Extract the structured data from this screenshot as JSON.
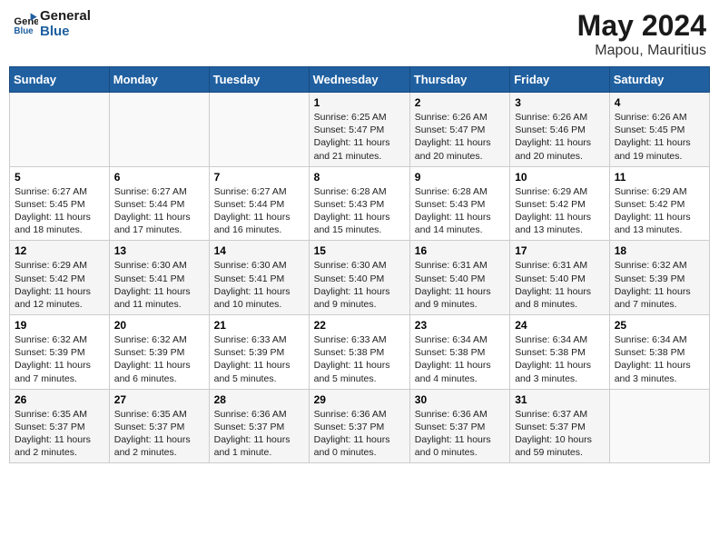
{
  "header": {
    "logo_line1": "General",
    "logo_line2": "Blue",
    "month": "May 2024",
    "location": "Mapou, Mauritius"
  },
  "weekdays": [
    "Sunday",
    "Monday",
    "Tuesday",
    "Wednesday",
    "Thursday",
    "Friday",
    "Saturday"
  ],
  "weeks": [
    [
      {
        "day": "",
        "info": ""
      },
      {
        "day": "",
        "info": ""
      },
      {
        "day": "",
        "info": ""
      },
      {
        "day": "1",
        "info": "Sunrise: 6:25 AM\nSunset: 5:47 PM\nDaylight: 11 hours\nand 21 minutes."
      },
      {
        "day": "2",
        "info": "Sunrise: 6:26 AM\nSunset: 5:47 PM\nDaylight: 11 hours\nand 20 minutes."
      },
      {
        "day": "3",
        "info": "Sunrise: 6:26 AM\nSunset: 5:46 PM\nDaylight: 11 hours\nand 20 minutes."
      },
      {
        "day": "4",
        "info": "Sunrise: 6:26 AM\nSunset: 5:45 PM\nDaylight: 11 hours\nand 19 minutes."
      }
    ],
    [
      {
        "day": "5",
        "info": "Sunrise: 6:27 AM\nSunset: 5:45 PM\nDaylight: 11 hours\nand 18 minutes."
      },
      {
        "day": "6",
        "info": "Sunrise: 6:27 AM\nSunset: 5:44 PM\nDaylight: 11 hours\nand 17 minutes."
      },
      {
        "day": "7",
        "info": "Sunrise: 6:27 AM\nSunset: 5:44 PM\nDaylight: 11 hours\nand 16 minutes."
      },
      {
        "day": "8",
        "info": "Sunrise: 6:28 AM\nSunset: 5:43 PM\nDaylight: 11 hours\nand 15 minutes."
      },
      {
        "day": "9",
        "info": "Sunrise: 6:28 AM\nSunset: 5:43 PM\nDaylight: 11 hours\nand 14 minutes."
      },
      {
        "day": "10",
        "info": "Sunrise: 6:29 AM\nSunset: 5:42 PM\nDaylight: 11 hours\nand 13 minutes."
      },
      {
        "day": "11",
        "info": "Sunrise: 6:29 AM\nSunset: 5:42 PM\nDaylight: 11 hours\nand 13 minutes."
      }
    ],
    [
      {
        "day": "12",
        "info": "Sunrise: 6:29 AM\nSunset: 5:42 PM\nDaylight: 11 hours\nand 12 minutes."
      },
      {
        "day": "13",
        "info": "Sunrise: 6:30 AM\nSunset: 5:41 PM\nDaylight: 11 hours\nand 11 minutes."
      },
      {
        "day": "14",
        "info": "Sunrise: 6:30 AM\nSunset: 5:41 PM\nDaylight: 11 hours\nand 10 minutes."
      },
      {
        "day": "15",
        "info": "Sunrise: 6:30 AM\nSunset: 5:40 PM\nDaylight: 11 hours\nand 9 minutes."
      },
      {
        "day": "16",
        "info": "Sunrise: 6:31 AM\nSunset: 5:40 PM\nDaylight: 11 hours\nand 9 minutes."
      },
      {
        "day": "17",
        "info": "Sunrise: 6:31 AM\nSunset: 5:40 PM\nDaylight: 11 hours\nand 8 minutes."
      },
      {
        "day": "18",
        "info": "Sunrise: 6:32 AM\nSunset: 5:39 PM\nDaylight: 11 hours\nand 7 minutes."
      }
    ],
    [
      {
        "day": "19",
        "info": "Sunrise: 6:32 AM\nSunset: 5:39 PM\nDaylight: 11 hours\nand 7 minutes."
      },
      {
        "day": "20",
        "info": "Sunrise: 6:32 AM\nSunset: 5:39 PM\nDaylight: 11 hours\nand 6 minutes."
      },
      {
        "day": "21",
        "info": "Sunrise: 6:33 AM\nSunset: 5:39 PM\nDaylight: 11 hours\nand 5 minutes."
      },
      {
        "day": "22",
        "info": "Sunrise: 6:33 AM\nSunset: 5:38 PM\nDaylight: 11 hours\nand 5 minutes."
      },
      {
        "day": "23",
        "info": "Sunrise: 6:34 AM\nSunset: 5:38 PM\nDaylight: 11 hours\nand 4 minutes."
      },
      {
        "day": "24",
        "info": "Sunrise: 6:34 AM\nSunset: 5:38 PM\nDaylight: 11 hours\nand 3 minutes."
      },
      {
        "day": "25",
        "info": "Sunrise: 6:34 AM\nSunset: 5:38 PM\nDaylight: 11 hours\nand 3 minutes."
      }
    ],
    [
      {
        "day": "26",
        "info": "Sunrise: 6:35 AM\nSunset: 5:37 PM\nDaylight: 11 hours\nand 2 minutes."
      },
      {
        "day": "27",
        "info": "Sunrise: 6:35 AM\nSunset: 5:37 PM\nDaylight: 11 hours\nand 2 minutes."
      },
      {
        "day": "28",
        "info": "Sunrise: 6:36 AM\nSunset: 5:37 PM\nDaylight: 11 hours\nand 1 minute."
      },
      {
        "day": "29",
        "info": "Sunrise: 6:36 AM\nSunset: 5:37 PM\nDaylight: 11 hours\nand 0 minutes."
      },
      {
        "day": "30",
        "info": "Sunrise: 6:36 AM\nSunset: 5:37 PM\nDaylight: 11 hours\nand 0 minutes."
      },
      {
        "day": "31",
        "info": "Sunrise: 6:37 AM\nSunset: 5:37 PM\nDaylight: 10 hours\nand 59 minutes."
      },
      {
        "day": "",
        "info": ""
      }
    ]
  ]
}
